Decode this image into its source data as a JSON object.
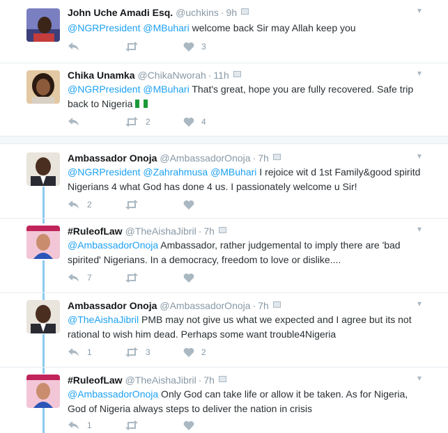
{
  "tweets": [
    {
      "name": "John Uche Amadi Esq.",
      "handle": "@uchkins",
      "time": "9h",
      "mentions": [
        "@NGRPresident",
        "@MBuhari"
      ],
      "text": " welcome back Sir may Allah keep you",
      "retweets": "",
      "likes": "3",
      "replies": ""
    },
    {
      "name": "Chika Unamka",
      "handle": "@ChikaNworah",
      "time": "11h",
      "mentions": [
        "@NGRPresident",
        "@MBuhari"
      ],
      "text": " That's great, hope you are fully recovered. Safe trip back to Nigeria",
      "retweets": "2",
      "likes": "4",
      "replies": ""
    },
    {
      "name": "Ambassador Onoja",
      "handle": "@AmbassadorOnoja",
      "time": "7h",
      "mentions": [
        "@NGRPresident",
        "@Zahrahmusa",
        "@MBuhari"
      ],
      "text": " I rejoice wit d 1st Family&good spiritd Nigerians 4 what God has done 4 us. I passionately welcome u Sir!",
      "retweets": "",
      "likes": "",
      "replies": "2"
    },
    {
      "name": "#RuleofLaw",
      "handle": "@TheAishaJibril",
      "time": "7h",
      "mentions": [
        "@AmbassadorOnoja"
      ],
      "text": "  Ambassador, rather judgemental to imply there are 'bad spirited' Nigerians. In a democracy, freedom to love or dislike....",
      "retweets": "",
      "likes": "",
      "replies": "7"
    },
    {
      "name": "Ambassador Onoja",
      "handle": "@AmbassadorOnoja",
      "time": "7h",
      "mentions": [
        "@TheAishaJibril"
      ],
      "text": " PMB may not give us what we expected and I agree but its not rational to wish him dead. Perhaps some want trouble4Nigeria",
      "retweets": "3",
      "likes": "2",
      "replies": "1"
    },
    {
      "name": "#RuleofLaw",
      "handle": "@TheAishaJibril",
      "time": "7h",
      "mentions": [
        "@AmbassadorOnoja"
      ],
      "text": " Only God can take life or allow it be taken. As for Nigeria, God of Nigeria always steps to deliver the nation in crisis",
      "retweets": "",
      "likes": "",
      "replies": "1"
    }
  ],
  "dot": "·",
  "chevron": "▾",
  "colors": {
    "link": "#1da1f2",
    "thread": "#8ccaef",
    "icon": "#aab8c2"
  }
}
